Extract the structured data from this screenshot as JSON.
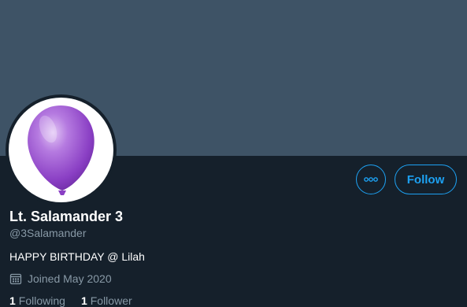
{
  "profile": {
    "name": "Lt. Salamander 3",
    "handle": "@3Salamander",
    "bio": "HAPPY BIRTHDAY @ Lilah",
    "joined": "Joined May 2020",
    "following_count": "1",
    "following_label": "Following",
    "followers_count": "1",
    "followers_label": "Follower"
  },
  "actions": {
    "follow_label": "Follow"
  },
  "colors": {
    "accent": "#1da1f2",
    "background": "#15202b",
    "banner": "#3e5366",
    "secondary_text": "#8899a6"
  },
  "icons": {
    "more": "more-icon",
    "calendar": "calendar-icon",
    "avatar": "balloon-avatar"
  }
}
